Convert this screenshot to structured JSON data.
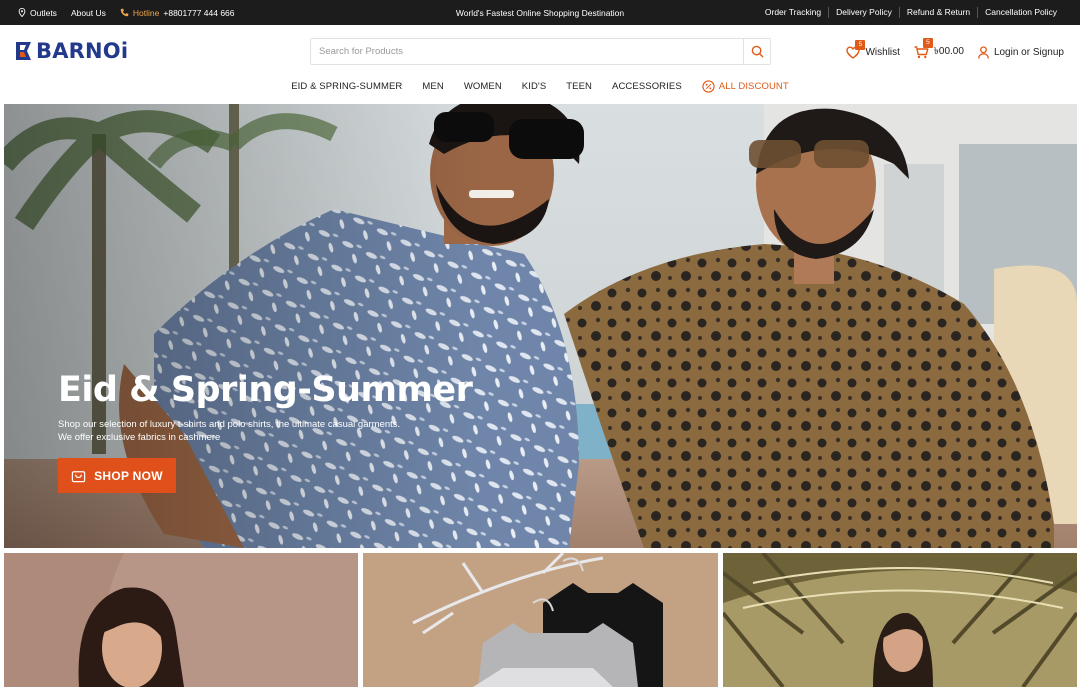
{
  "topbar": {
    "outlets": "Outlets",
    "about": "About Us",
    "hotline_label": "Hotline",
    "hotline_number": "+8801777 444 666",
    "tagline": "World's Fastest Online Shopping Destination",
    "links": [
      "Order Tracking",
      "Delivery Policy",
      "Refund & Return",
      "Cancellation Policy"
    ]
  },
  "brand": {
    "name": "BARNOi",
    "color": "#233a8c"
  },
  "search": {
    "placeholder": "Search for Products",
    "value": ""
  },
  "header": {
    "wishlist_label": "Wishlist",
    "wishlist_count": "5",
    "cart_count": "5",
    "cart_total": "৳00.00",
    "login_label": "Login or Signup"
  },
  "nav": {
    "items": [
      "EID & SPRING-SUMMER",
      "MEN",
      "WOMEN",
      "KID'S",
      "TEEN",
      "ACCESSORIES"
    ],
    "discount": "ALL DISCOUNT"
  },
  "hero": {
    "title": "Eid & Spring-Summer",
    "subtitle_line1": "Shop our selection of luxury t-shirts and polo shirts, the ultimate casual garments.",
    "subtitle_line2": "We offer exclusive fabrics in cashmere",
    "button": "SHOP NOW"
  },
  "colors": {
    "accent": "#e0501a",
    "topbar": "#1c1c1c",
    "hotline": "#f0a44a"
  },
  "icons": [
    "map-pin-icon",
    "phone-icon",
    "search-icon",
    "heart-icon",
    "cart-icon",
    "user-icon",
    "percent-icon",
    "bag-icon"
  ]
}
